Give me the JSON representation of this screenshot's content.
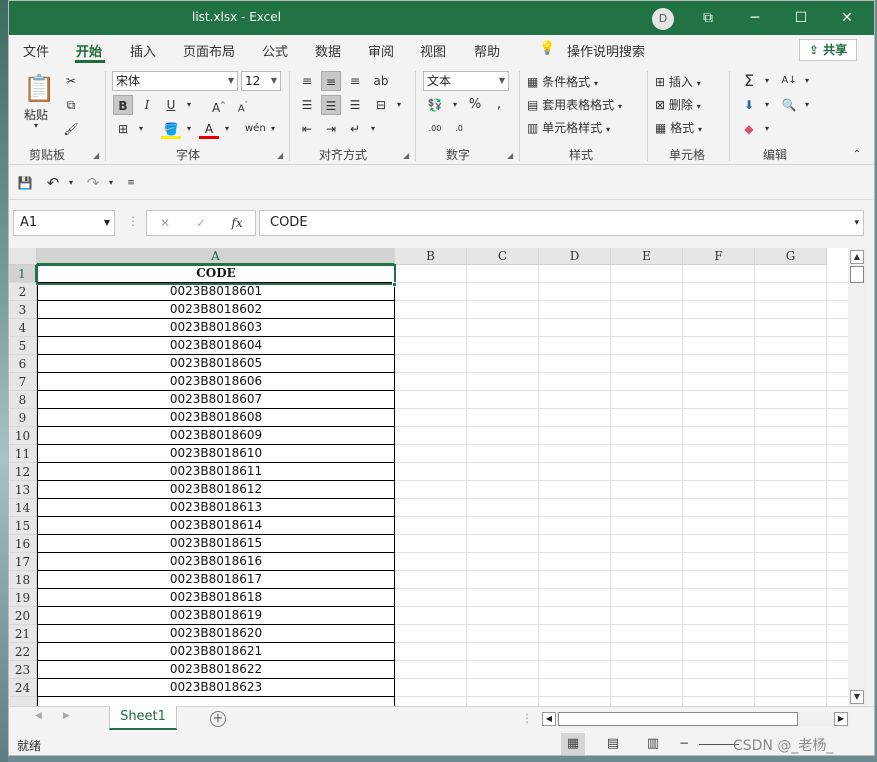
{
  "window": {
    "title": "list.xlsx  -  Excel",
    "user_initial": "D",
    "minimize": "─",
    "maximize": "☐",
    "close": "✕",
    "restore": "⧉"
  },
  "tabs": [
    "文件",
    "开始",
    "插入",
    "页面布局",
    "公式",
    "数据",
    "审阅",
    "视图",
    "帮助"
  ],
  "tell_me": "操作说明搜索",
  "share": "共享",
  "ribbon": {
    "clipboard": {
      "label": "剪贴板",
      "paste": "粘贴"
    },
    "font": {
      "label": "字体",
      "name": "宋体",
      "size": "12"
    },
    "alignment": {
      "label": "对齐方式"
    },
    "number": {
      "label": "数字",
      "format": "文本"
    },
    "styles": {
      "label": "样式",
      "conditional": "条件格式",
      "table": "套用表格格式",
      "cell_styles": "单元格样式"
    },
    "cells": {
      "label": "单元格",
      "insert": "插入",
      "delete": "删除",
      "format": "格式"
    },
    "editing": {
      "label": "编辑"
    }
  },
  "formula_bar": {
    "name_box": "A1",
    "formula": "CODE",
    "fx": "fx"
  },
  "columns": [
    "A",
    "B",
    "C",
    "D",
    "E",
    "F",
    "G"
  ],
  "rows": [
    "1",
    "2",
    "3",
    "4",
    "5",
    "6",
    "7",
    "8",
    "9",
    "10",
    "11",
    "12",
    "13",
    "14",
    "15",
    "16",
    "17",
    "18",
    "19",
    "20",
    "21",
    "22",
    "23",
    "24"
  ],
  "cells_a": [
    "CODE",
    "0023B8018601",
    "0023B8018602",
    "0023B8018603",
    "0023B8018604",
    "0023B8018605",
    "0023B8018606",
    "0023B8018607",
    "0023B8018608",
    "0023B8018609",
    "0023B8018610",
    "0023B8018611",
    "0023B8018612",
    "0023B8018613",
    "0023B8018614",
    "0023B8018615",
    "0023B8018616",
    "0023B8018617",
    "0023B8018618",
    "0023B8018619",
    "0023B8018620",
    "0023B8018621",
    "0023B8018622",
    "0023B8018623"
  ],
  "sheet_tab": "Sheet1",
  "status": {
    "ready": "就绪",
    "watermark": "CSDN @_老杨_"
  },
  "colors": {
    "excel_green": "#217346",
    "accent_text": "#1e6b3c"
  }
}
